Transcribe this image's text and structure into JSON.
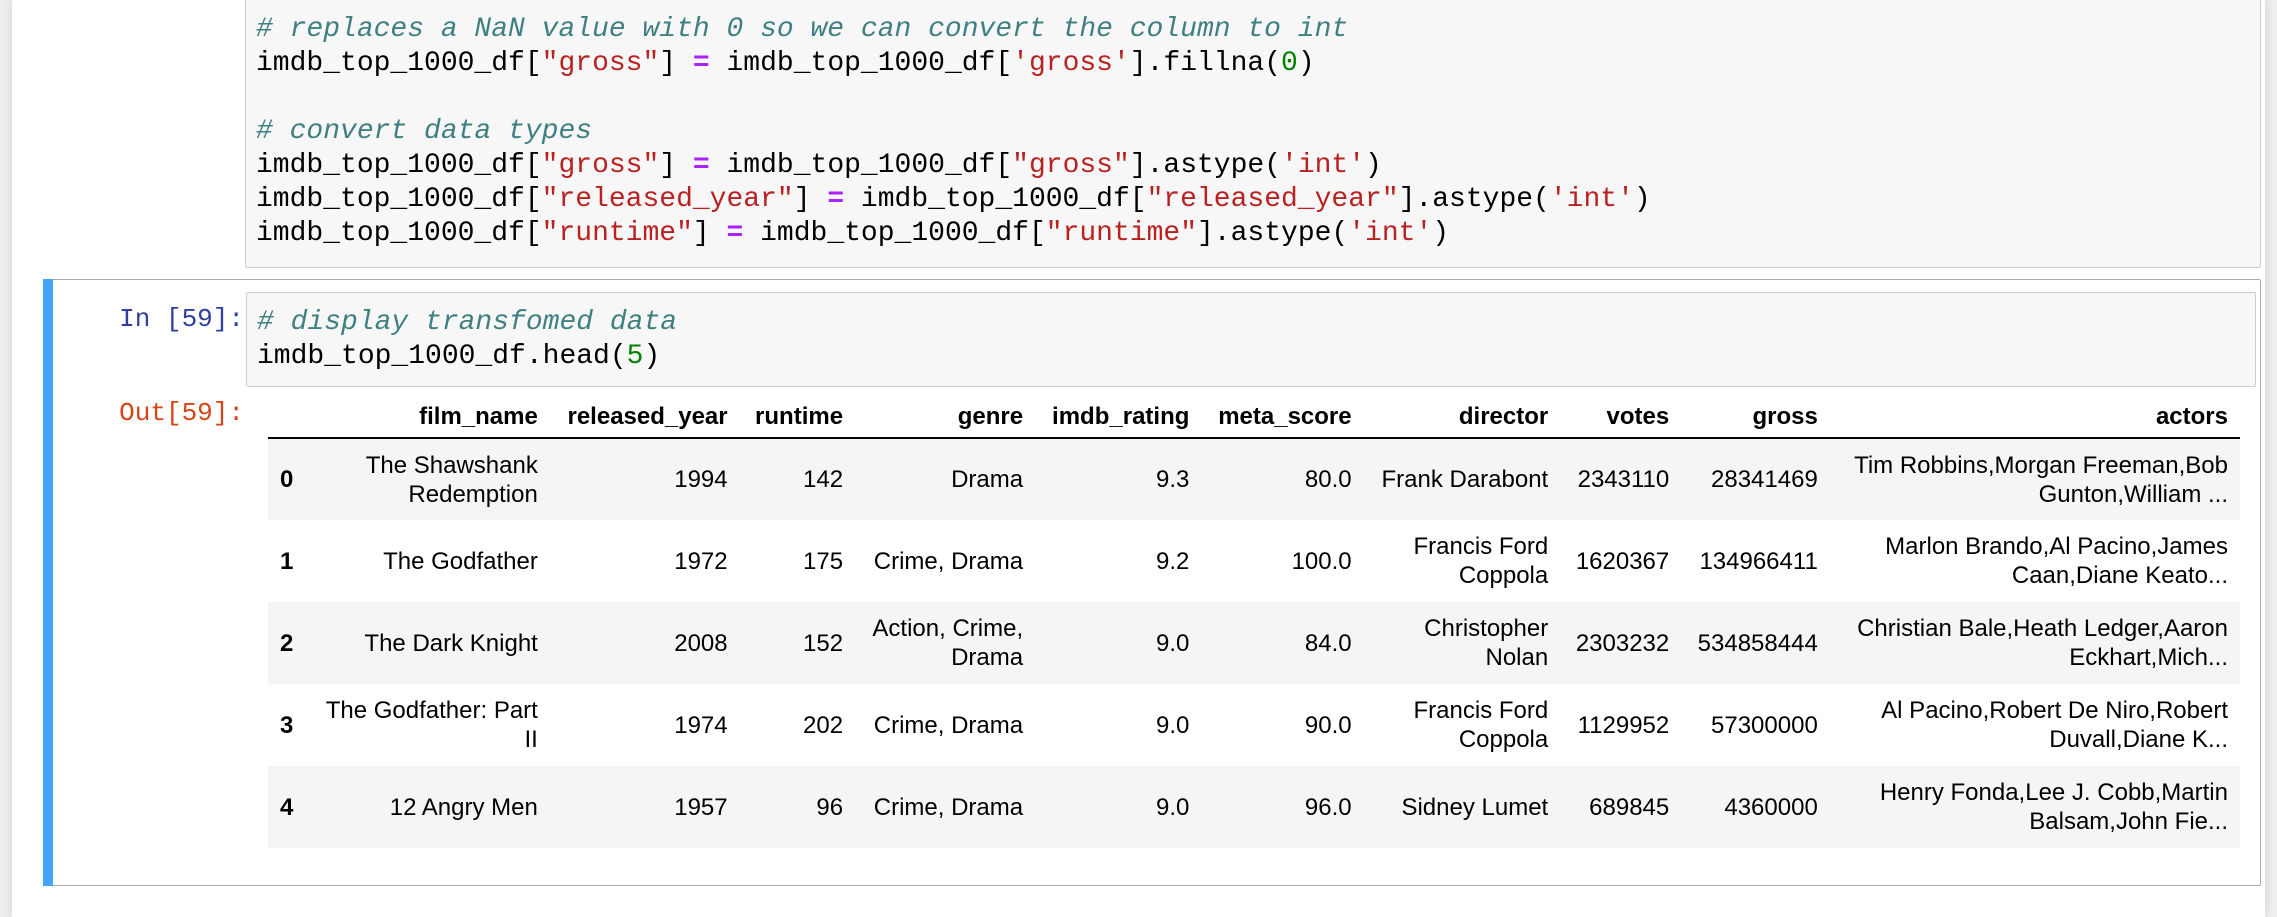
{
  "previous_cell": {
    "lines": [
      {
        "type": "comment",
        "text": "# replaces a NaN value with 0 so we can convert the column to int"
      },
      {
        "type": "code",
        "parts": [
          [
            "t",
            "imdb_top_1000_df["
          ],
          [
            "s",
            "\"gross\""
          ],
          [
            "t",
            "] "
          ],
          [
            "o",
            "="
          ],
          [
            "t",
            " imdb_top_1000_df["
          ],
          [
            "s",
            "'gross'"
          ],
          [
            "t",
            "].fillna("
          ],
          [
            "n",
            "0"
          ],
          [
            "t",
            ")"
          ]
        ]
      },
      {
        "type": "blank",
        "text": ""
      },
      {
        "type": "comment",
        "text": "# convert data types"
      },
      {
        "type": "code",
        "parts": [
          [
            "t",
            "imdb_top_1000_df["
          ],
          [
            "s",
            "\"gross\""
          ],
          [
            "t",
            "] "
          ],
          [
            "o",
            "="
          ],
          [
            "t",
            " imdb_top_1000_df["
          ],
          [
            "s",
            "\"gross\""
          ],
          [
            "t",
            "].astype("
          ],
          [
            "s",
            "'int'"
          ],
          [
            "t",
            ")"
          ]
        ]
      },
      {
        "type": "code",
        "parts": [
          [
            "t",
            "imdb_top_1000_df["
          ],
          [
            "s",
            "\"released_year\""
          ],
          [
            "t",
            "] "
          ],
          [
            "o",
            "="
          ],
          [
            "t",
            " imdb_top_1000_df["
          ],
          [
            "s",
            "\"released_year\""
          ],
          [
            "t",
            "].astype("
          ],
          [
            "s",
            "'int'"
          ],
          [
            "t",
            ")"
          ]
        ]
      },
      {
        "type": "code",
        "parts": [
          [
            "t",
            "imdb_top_1000_df["
          ],
          [
            "s",
            "\"runtime\""
          ],
          [
            "t",
            "] "
          ],
          [
            "o",
            "="
          ],
          [
            "t",
            " imdb_top_1000_df["
          ],
          [
            "s",
            "\"runtime\""
          ],
          [
            "t",
            "].astype("
          ],
          [
            "s",
            "'int'"
          ],
          [
            "t",
            ")"
          ]
        ]
      }
    ]
  },
  "current_cell": {
    "in_prompt": "In [59]:",
    "out_prompt": "Out[59]:",
    "lines": [
      {
        "type": "comment",
        "text": "# display transfomed data"
      },
      {
        "type": "code",
        "parts": [
          [
            "t",
            "imdb_top_1000_df.head("
          ],
          [
            "n",
            "5"
          ],
          [
            "t",
            ")"
          ]
        ]
      }
    ]
  },
  "table": {
    "columns": [
      "",
      "film_name",
      "released_year",
      "runtime",
      "genre",
      "imdb_rating",
      "meta_score",
      "director",
      "votes",
      "gross",
      "actors"
    ],
    "rows": [
      [
        "0",
        "The Shawshank\nRedemption",
        "1994",
        "142",
        "Drama",
        "9.3",
        "80.0",
        "Frank Darabont",
        "2343110",
        "28341469",
        "Tim Robbins,Morgan Freeman,Bob\nGunton,William ..."
      ],
      [
        "1",
        "The Godfather",
        "1972",
        "175",
        "Crime, Drama",
        "9.2",
        "100.0",
        "Francis Ford\nCoppola",
        "1620367",
        "134966411",
        "Marlon Brando,Al Pacino,James\nCaan,Diane Keato..."
      ],
      [
        "2",
        "The Dark Knight",
        "2008",
        "152",
        "Action, Crime,\nDrama",
        "9.0",
        "84.0",
        "Christopher\nNolan",
        "2303232",
        "534858444",
        "Christian Bale,Heath Ledger,Aaron\nEckhart,Mich..."
      ],
      [
        "3",
        "The Godfather: Part\nII",
        "1974",
        "202",
        "Crime, Drama",
        "9.0",
        "90.0",
        "Francis Ford\nCoppola",
        "1129952",
        "57300000",
        "Al Pacino,Robert De Niro,Robert\nDuvall,Diane K..."
      ],
      [
        "4",
        "12 Angry Men",
        "1957",
        "96",
        "Crime, Drama",
        "9.0",
        "96.0",
        "Sidney Lumet",
        "689845",
        "4360000",
        "Henry Fonda,Lee J. Cobb,Martin\nBalsam,John Fie..."
      ]
    ]
  },
  "colors": {
    "selected_bar": "#42a5f5",
    "in_prompt": "#303f9f",
    "out_prompt": "#d84315",
    "comment": "#408080",
    "string": "#ba2121",
    "operator": "#aa22ff",
    "number": "#008000"
  }
}
